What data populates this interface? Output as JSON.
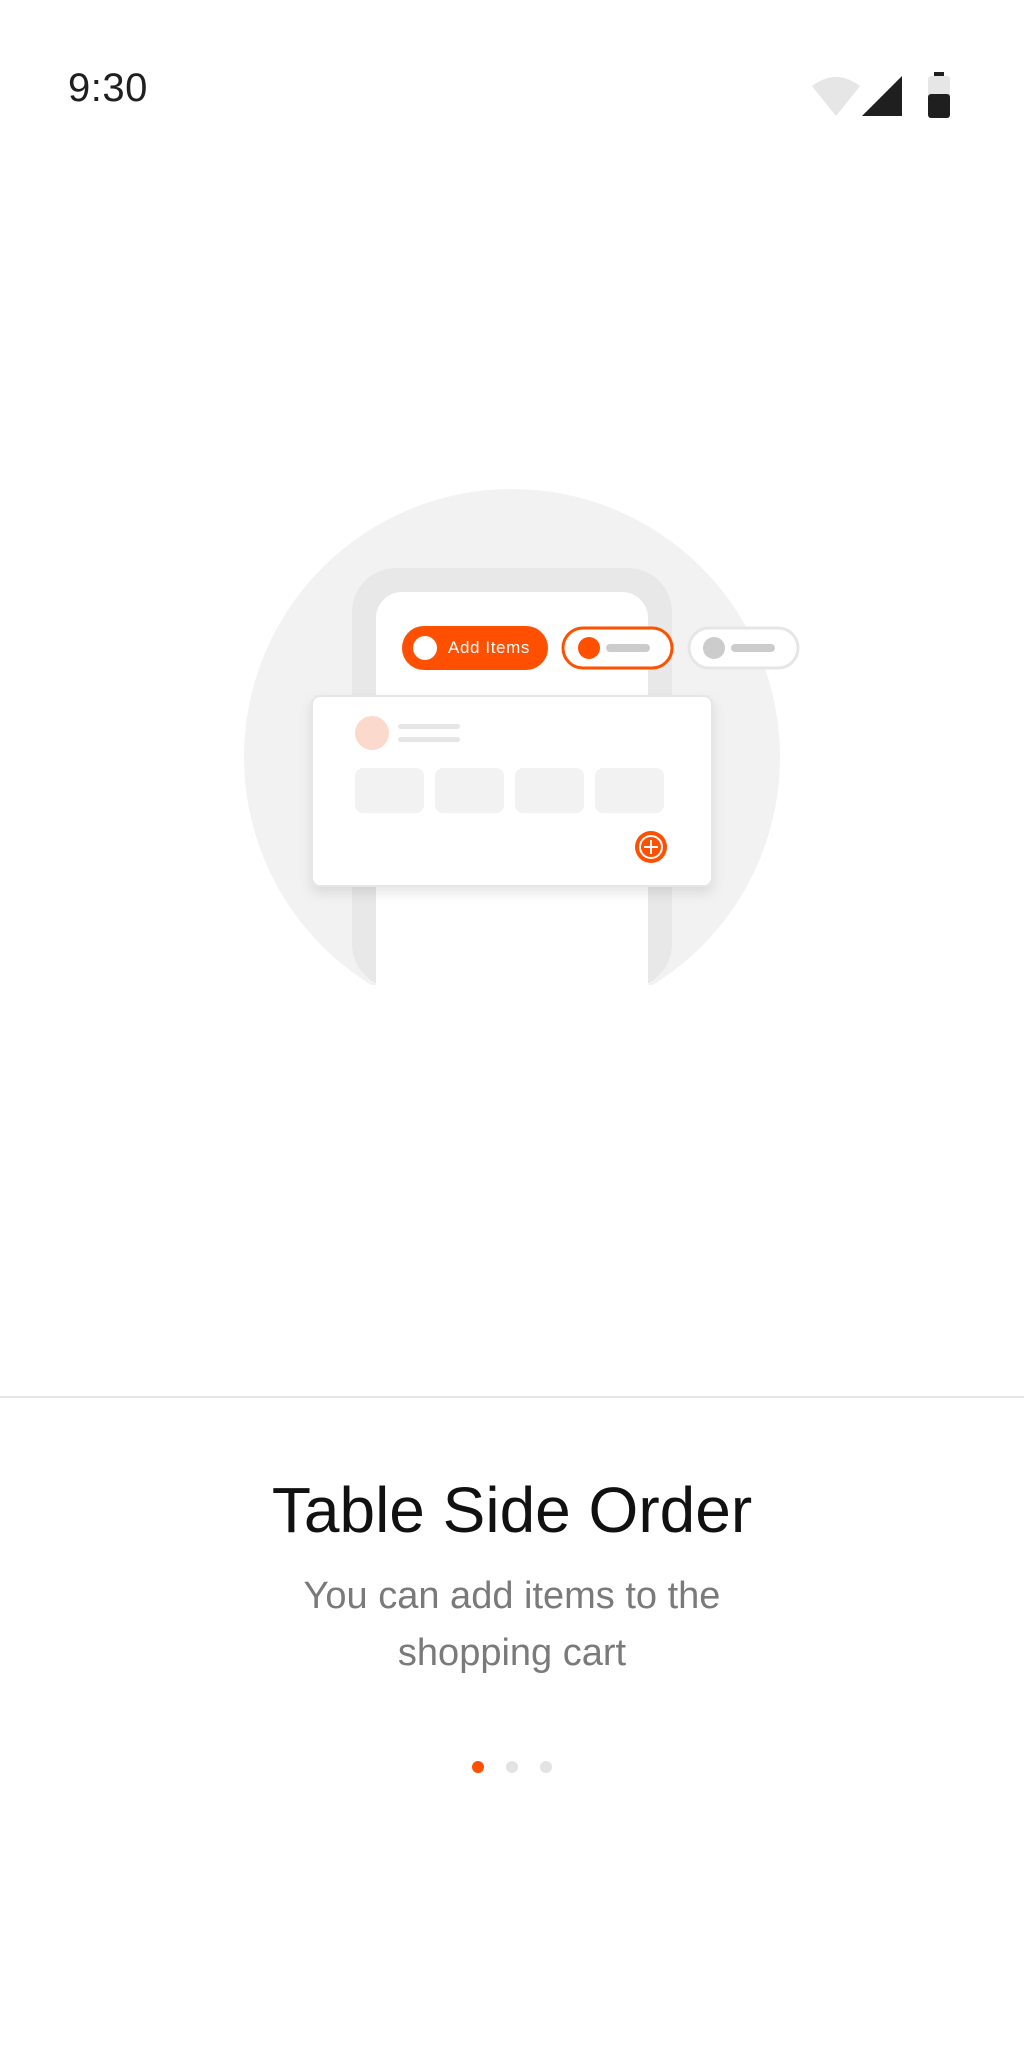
{
  "status_bar": {
    "time": "9:30",
    "icons": [
      "wifi-icon",
      "signal-icon",
      "battery-icon"
    ]
  },
  "illustration": {
    "chip_label": "Add Items",
    "icons": [
      "phone-frame-icon",
      "toggle-chip-icon",
      "add-circle-icon",
      "avatar-placeholder-icon"
    ]
  },
  "onboarding": {
    "title": "Table Side Order",
    "subtitle": "You can add items to the shopping cart",
    "pages": [
      {
        "active": true
      },
      {
        "active": false
      },
      {
        "active": false
      }
    ]
  },
  "colors": {
    "accent": "#ff4f00",
    "accent_light": "#fbd9cc",
    "illustration_bg": "#f2f2f2",
    "text_primary": "#111111",
    "text_secondary": "#7a7a7a",
    "divider": "#e6e6e6"
  }
}
